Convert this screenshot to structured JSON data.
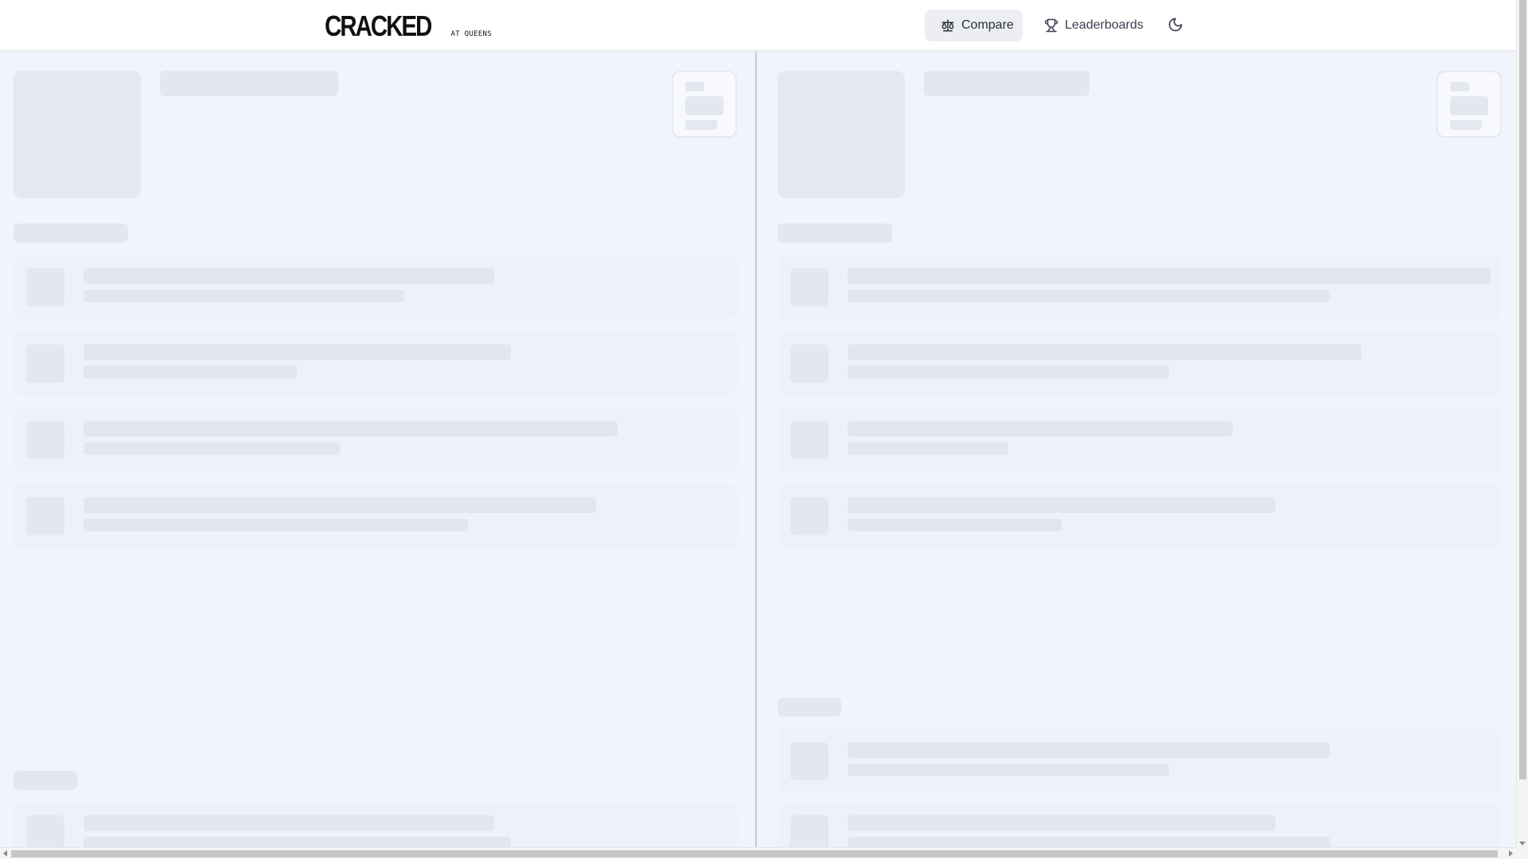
{
  "brand": {
    "name": "CRACKED",
    "tagline": "AT QUEENS"
  },
  "nav": {
    "compare_label": "Compare",
    "leaderboards_label": "Leaderboards"
  },
  "state": "loading",
  "colors": {
    "background": "#f1f4fc",
    "skeleton": "#e3e7f1",
    "active_nav_bg": "#eceef2"
  }
}
